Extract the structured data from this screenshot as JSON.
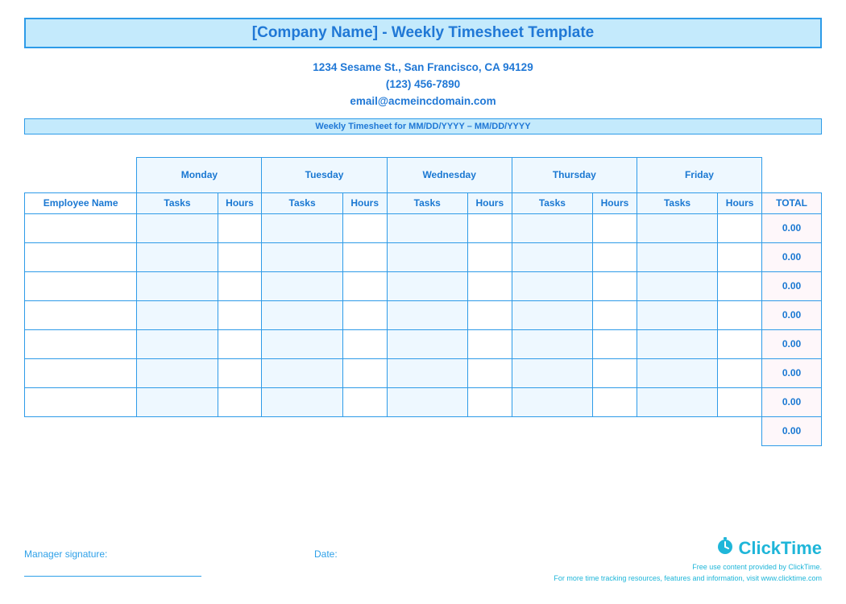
{
  "title": "[Company Name] - Weekly Timesheet Template",
  "address_line": "1234 Sesame St.,  San Francisco, CA 94129",
  "phone": "(123) 456-7890",
  "email": "email@acmeincdomain.com",
  "period_label": "Weekly Timesheet for MM/DD/YYYY – MM/DD/YYYY",
  "headers": {
    "employee": "Employee Name",
    "days": [
      "Monday",
      "Tuesday",
      "Wednesday",
      "Thursday",
      "Friday"
    ],
    "tasks": "Tasks",
    "hours": "Hours",
    "total": "TOTAL"
  },
  "rows": [
    {
      "employee": "",
      "cells": [
        "",
        "",
        "",
        "",
        "",
        "",
        "",
        "",
        "",
        ""
      ],
      "total": "0.00"
    },
    {
      "employee": "",
      "cells": [
        "",
        "",
        "",
        "",
        "",
        "",
        "",
        "",
        "",
        ""
      ],
      "total": "0.00"
    },
    {
      "employee": "",
      "cells": [
        "",
        "",
        "",
        "",
        "",
        "",
        "",
        "",
        "",
        ""
      ],
      "total": "0.00"
    },
    {
      "employee": "",
      "cells": [
        "",
        "",
        "",
        "",
        "",
        "",
        "",
        "",
        "",
        ""
      ],
      "total": "0.00"
    },
    {
      "employee": "",
      "cells": [
        "",
        "",
        "",
        "",
        "",
        "",
        "",
        "",
        "",
        ""
      ],
      "total": "0.00"
    },
    {
      "employee": "",
      "cells": [
        "",
        "",
        "",
        "",
        "",
        "",
        "",
        "",
        "",
        ""
      ],
      "total": "0.00"
    },
    {
      "employee": "",
      "cells": [
        "",
        "",
        "",
        "",
        "",
        "",
        "",
        "",
        "",
        ""
      ],
      "total": "0.00"
    }
  ],
  "grand_total": "0.00",
  "footer": {
    "signature_label": "Manager signature:",
    "date_label": "Date:"
  },
  "branding": {
    "name": "ClickTime",
    "line1": "Free use content provided by ClickTime.",
    "line2": "For more time tracking resources, features and information, visit www.clicktime.com"
  }
}
